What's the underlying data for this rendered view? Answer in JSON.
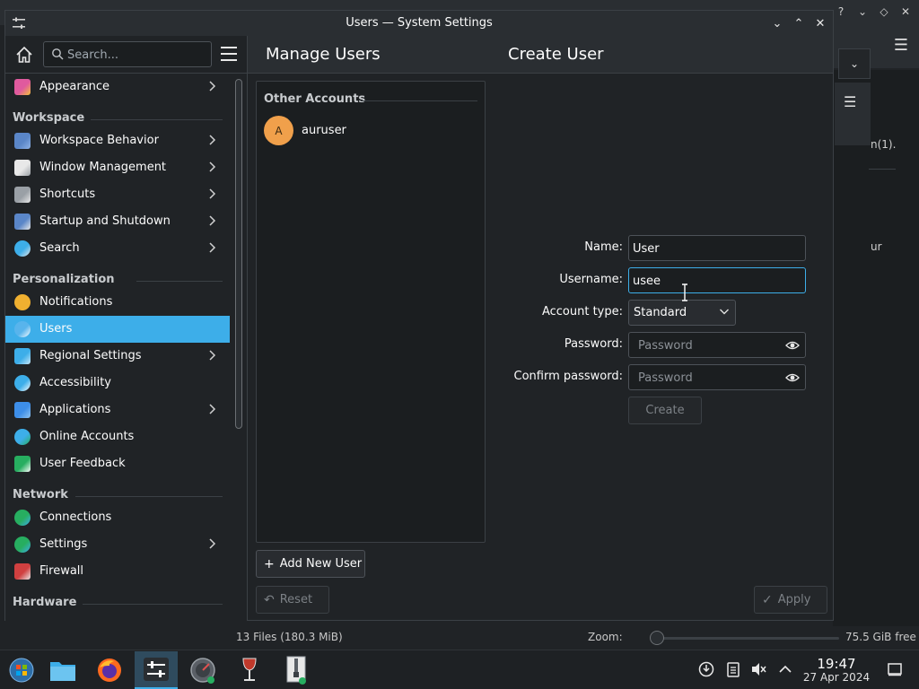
{
  "window": {
    "title": "Users — System Settings"
  },
  "background": {
    "status_files": "13 Files (180.3 MiB)",
    "zoom_label": "Zoom:",
    "free_space": "75.5 GiB free",
    "partial_text_1": "n(1).",
    "partial_text_2": "ur"
  },
  "sidebar": {
    "search_placeholder": "Search...",
    "items": [
      {
        "label": "Appearance",
        "icon": "appearance-icon",
        "has_children": true
      },
      {
        "category": "Workspace"
      },
      {
        "label": "Workspace Behavior",
        "icon": "workspace-behavior-icon",
        "has_children": true
      },
      {
        "label": "Window Management",
        "icon": "window-management-icon",
        "has_children": true
      },
      {
        "label": "Shortcuts",
        "icon": "keyboard-icon",
        "has_children": true
      },
      {
        "label": "Startup and Shutdown",
        "icon": "startup-icon",
        "has_children": true
      },
      {
        "label": "Search",
        "icon": "search-icon",
        "has_children": true
      },
      {
        "category": "Personalization"
      },
      {
        "label": "Notifications",
        "icon": "bell-icon",
        "has_children": false
      },
      {
        "label": "Users",
        "icon": "users-icon",
        "has_children": false,
        "selected": true
      },
      {
        "label": "Regional Settings",
        "icon": "regional-icon",
        "has_children": true
      },
      {
        "label": "Accessibility",
        "icon": "accessibility-icon",
        "has_children": false
      },
      {
        "label": "Applications",
        "icon": "applications-icon",
        "has_children": true
      },
      {
        "label": "Online Accounts",
        "icon": "online-accounts-icon",
        "has_children": false
      },
      {
        "label": "User Feedback",
        "icon": "feedback-icon",
        "has_children": false
      },
      {
        "category": "Network"
      },
      {
        "label": "Connections",
        "icon": "globe-icon",
        "has_children": false
      },
      {
        "label": "Settings",
        "icon": "network-settings-icon",
        "has_children": true
      },
      {
        "label": "Firewall",
        "icon": "firewall-icon",
        "has_children": false
      },
      {
        "category": "Hardware"
      }
    ]
  },
  "manage_users": {
    "heading": "Manage Users",
    "section": "Other Accounts",
    "accounts": [
      {
        "initial": "A",
        "name": "auruser"
      }
    ],
    "add_button": "Add New User",
    "reset_button": "Reset"
  },
  "create_user": {
    "heading": "Create User",
    "name_label": "Name:",
    "name_value": "User",
    "username_label": "Username:",
    "username_value": "usee",
    "account_type_label": "Account type:",
    "account_type_value": "Standard",
    "password_label": "Password:",
    "password_placeholder": "Password",
    "confirm_label": "Confirm password:",
    "confirm_placeholder": "Password",
    "create_button": "Create",
    "apply_button": "Apply"
  },
  "taskbar": {
    "time": "19:47",
    "date": "27 Apr 2024"
  },
  "colors": {
    "accent": "#3daee9",
    "avatar": "#f0a04b"
  }
}
